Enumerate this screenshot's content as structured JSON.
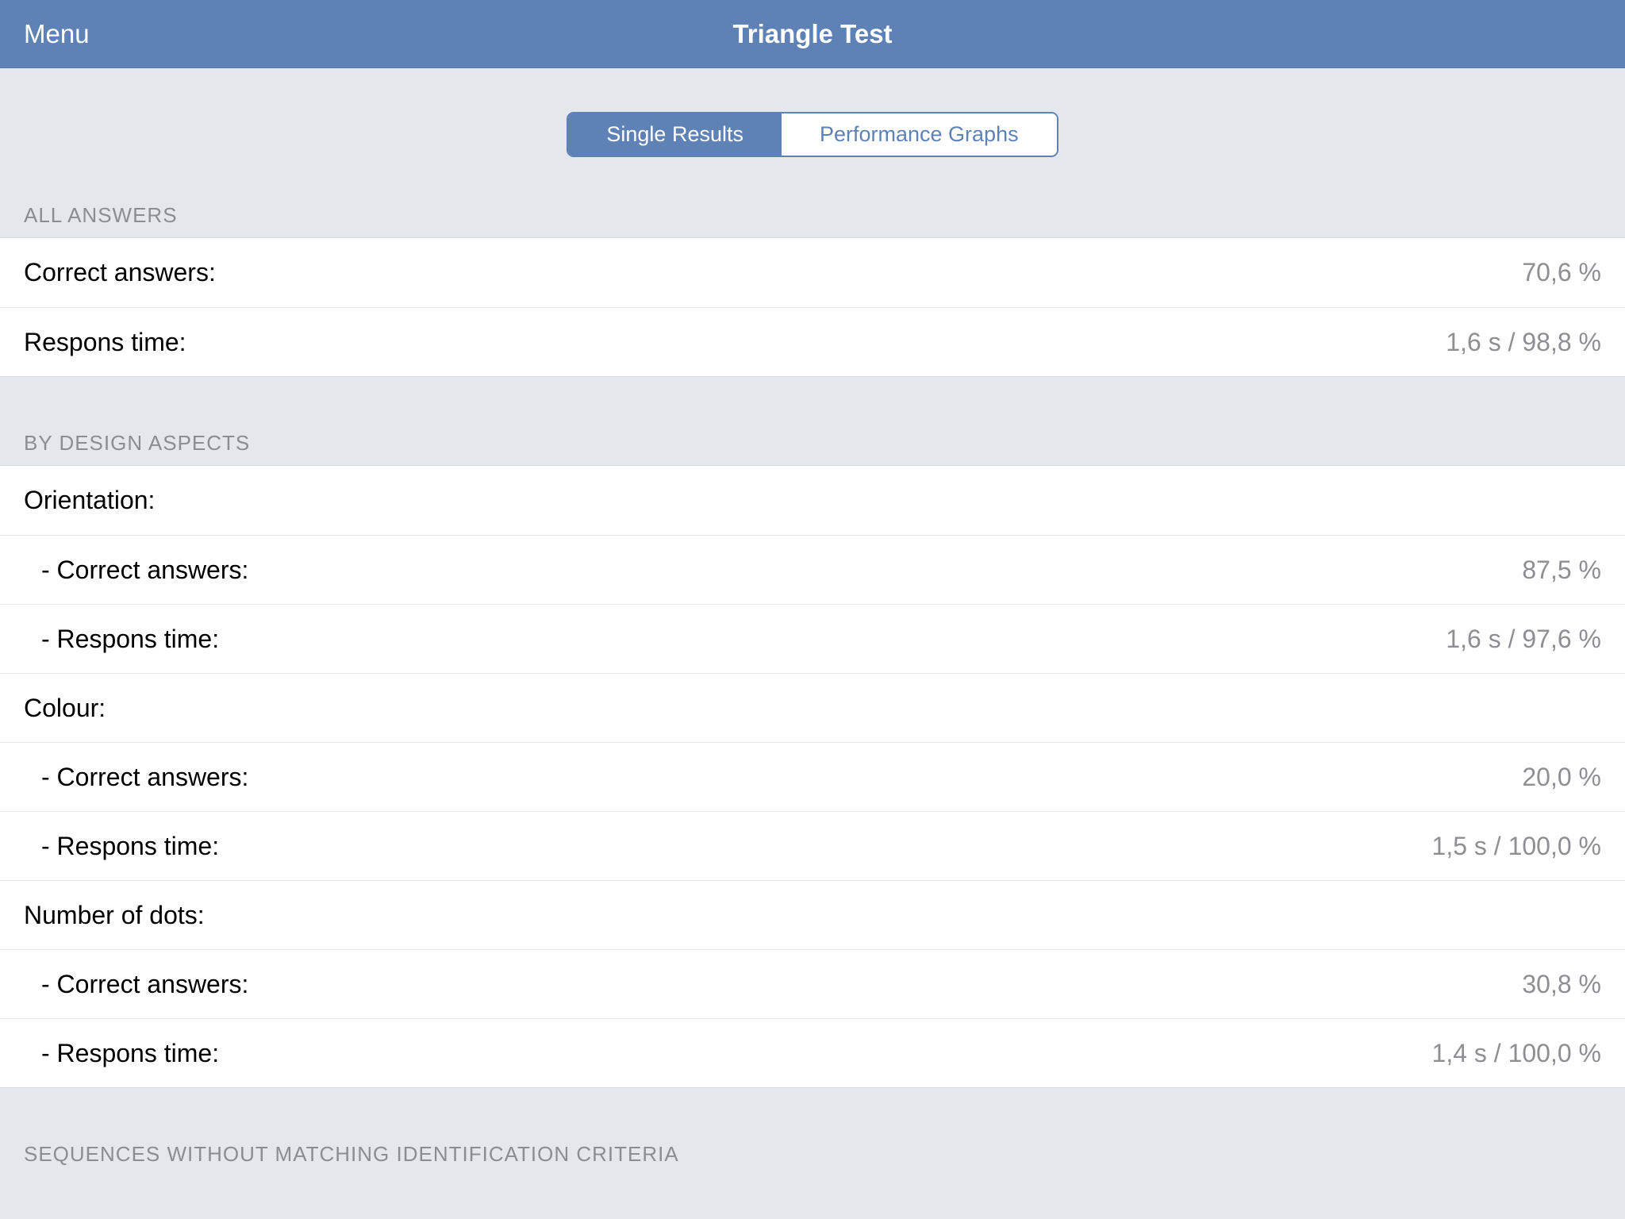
{
  "navbar": {
    "menu": "Menu",
    "title": "Triangle Test"
  },
  "segmented": {
    "single": "Single Results",
    "performance": "Performance Graphs"
  },
  "sections": {
    "all_answers": {
      "header": "ALL ANSWERS",
      "correct_label": "Correct answers:",
      "correct_value": "70,6 %",
      "respons_label": "Respons time:",
      "respons_value": "1,6 s / 98,8 %"
    },
    "by_design": {
      "header": "BY DESIGN ASPECTS",
      "orientation": {
        "title": "Orientation:",
        "correct_label": "- Correct answers:",
        "correct_value": "87,5 %",
        "respons_label": "- Respons time:",
        "respons_value": "1,6 s / 97,6 %"
      },
      "colour": {
        "title": "Colour:",
        "correct_label": "- Correct answers:",
        "correct_value": "20,0 %",
        "respons_label": "- Respons time:",
        "respons_value": "1,5 s / 100,0 %"
      },
      "dots": {
        "title": "Number of dots:",
        "correct_label": "- Correct answers:",
        "correct_value": "30,8 %",
        "respons_label": "- Respons time:",
        "respons_value": "1,4 s / 100,0 %"
      }
    },
    "sequences": {
      "header": "SEQUENCES WITHOUT MATCHING IDENTIFICATION CRITERIA"
    }
  }
}
